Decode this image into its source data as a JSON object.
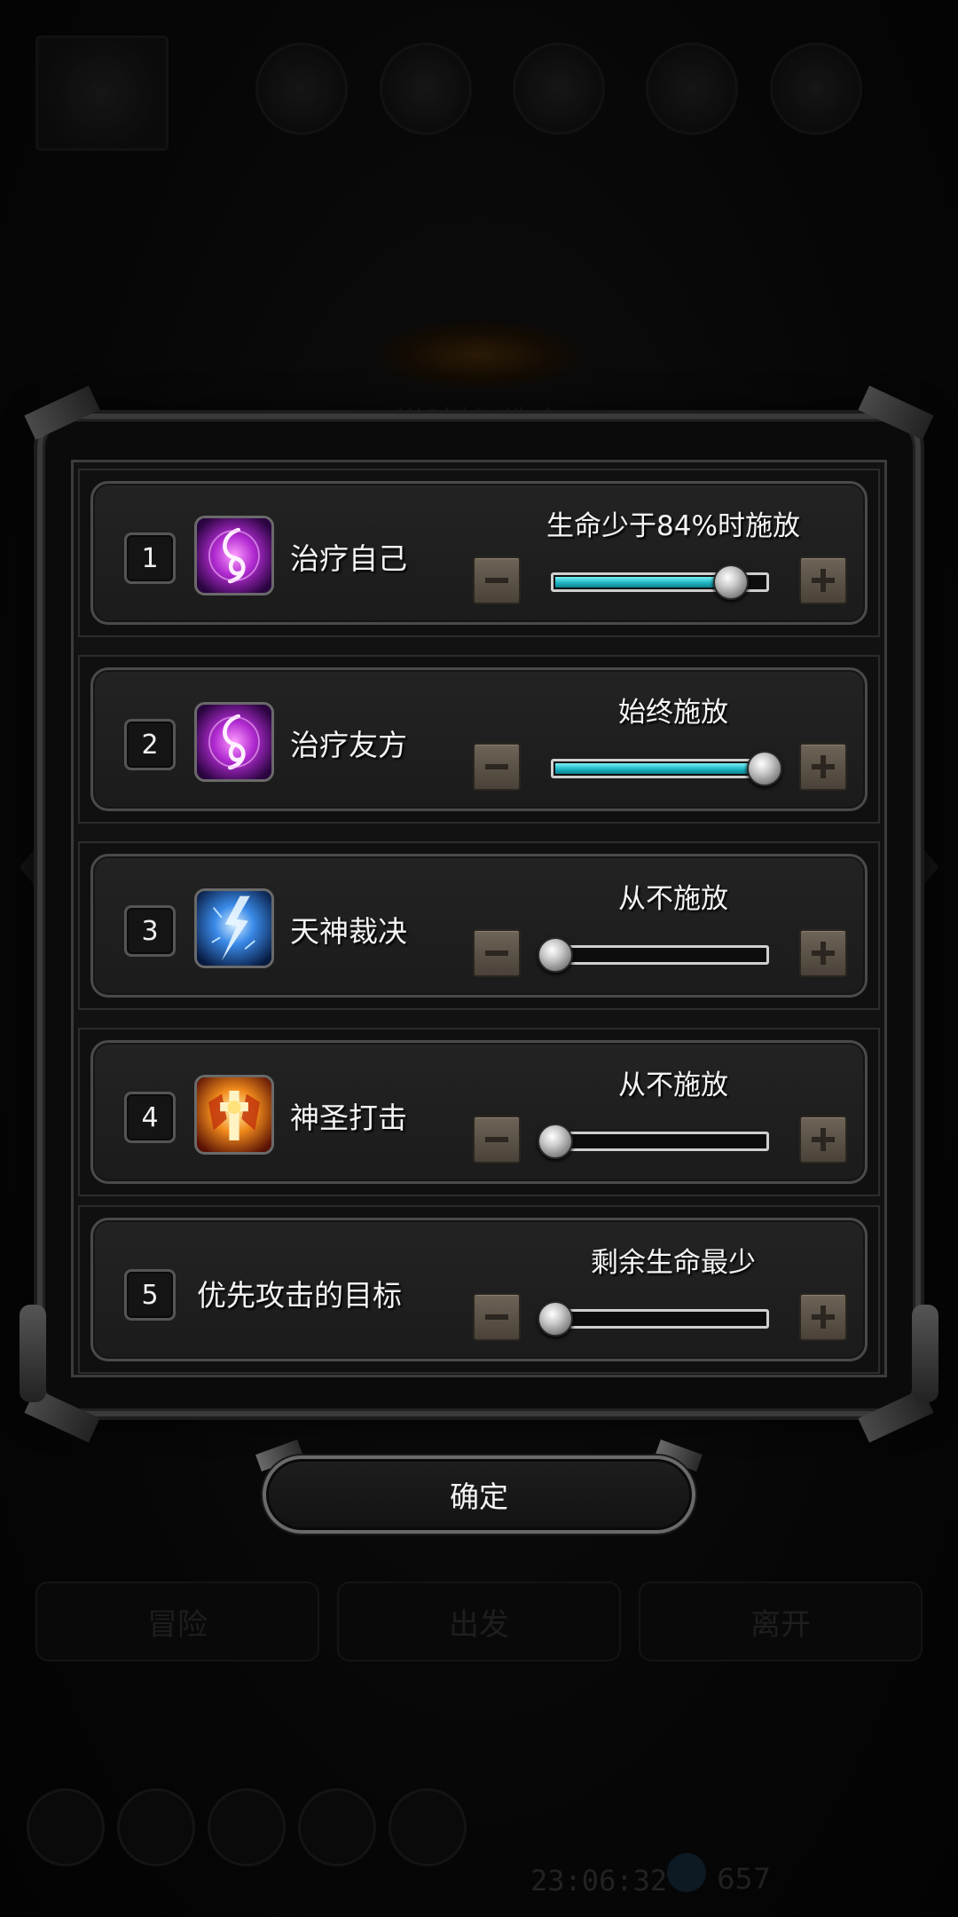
{
  "background": {
    "title": "塔珀拉 教室",
    "top_labels": [
      "",
      "",
      "",
      "",
      ""
    ],
    "tabs": [
      "冒险",
      "出发",
      "离开"
    ],
    "clock": "23:06:32",
    "currency_count": "657"
  },
  "dialog": {
    "rows": [
      {
        "number": "1",
        "skill_name": "治疗自己",
        "icon": "heal-self-icon",
        "setting_text": "生命少于84%时施放",
        "slider_fraction": 0.84
      },
      {
        "number": "2",
        "skill_name": "治疗友方",
        "icon": "heal-ally-icon",
        "setting_text": "始终施放",
        "slider_fraction": 1.0
      },
      {
        "number": "3",
        "skill_name": "天神裁决",
        "icon": "lightning-icon",
        "setting_text": "从不施放",
        "slider_fraction": 0.0
      },
      {
        "number": "4",
        "skill_name": "神圣打击",
        "icon": "holy-strike-icon",
        "setting_text": "从不施放",
        "slider_fraction": 0.0
      },
      {
        "number": "5",
        "skill_name": "优先攻击的目标",
        "icon": "",
        "setting_text": "剩余生命最少",
        "slider_fraction": 0.0
      }
    ],
    "confirm_label": "确定"
  },
  "colors": {
    "slider_fill": "#1fb5c4",
    "stepper_button": "#5c544a",
    "frame": "#3a3a3a"
  }
}
